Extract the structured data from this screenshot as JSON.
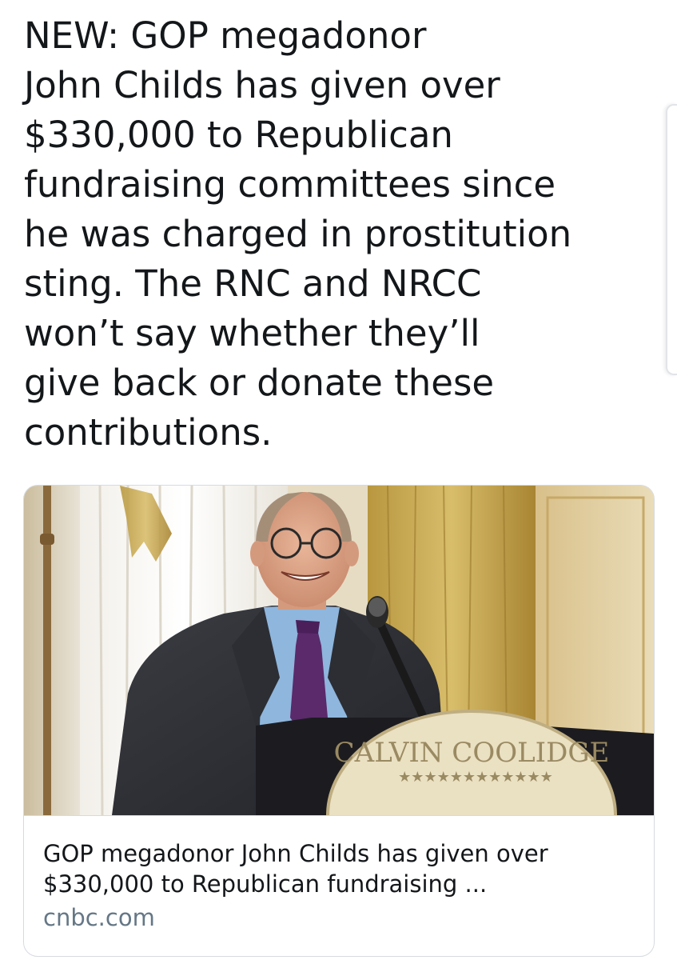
{
  "tweet": {
    "text": "NEW: GOP megadonor\nJohn Childs has given over\n$330,000 to Republican\nfundraising committees since\nhe was charged in prostitution\nsting. The RNC and NRCC\nwon’t say whether they’ll\ngive back or donate these\ncontributions."
  },
  "card": {
    "image": {
      "seal_text": "CALVIN COOLIDGE",
      "stars": "★★★★★★★★★★★★"
    },
    "title": "GOP megadonor John Childs has given over $330,000 to Republican fundraising ...",
    "domain": "cnbc.com"
  },
  "colors": {
    "text": "#14171a",
    "secondary_text": "#657786",
    "card_border": "#d6dbe0"
  }
}
